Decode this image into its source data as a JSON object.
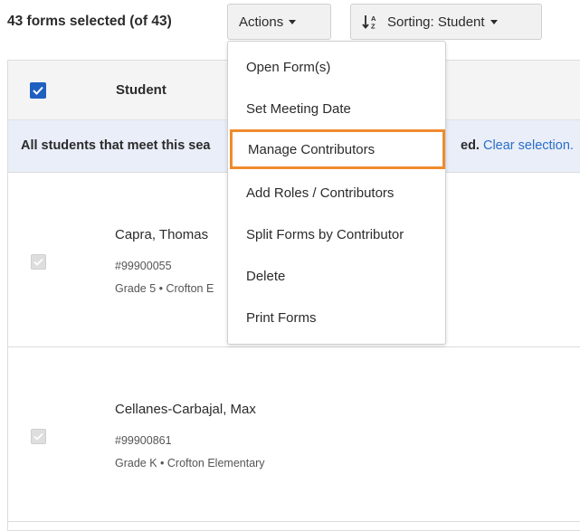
{
  "header": {
    "selection_count": "43 forms selected (of 43)",
    "actions_label": "Actions",
    "sorting_label": "Sorting: Student"
  },
  "table": {
    "column_student": "Student",
    "banner_text": "All students that meet this sea",
    "banner_tail": "ed.",
    "banner_link": "Clear selection."
  },
  "rows": [
    {
      "name": "Capra, Thomas",
      "id": "#99900055",
      "grade": "Grade 5 • Crofton E"
    },
    {
      "name": "Cellanes-Carbajal, Max",
      "id": "#99900861",
      "grade": "Grade K • Crofton Elementary"
    }
  ],
  "menu": {
    "items": [
      {
        "label": "Open Form(s)"
      },
      {
        "label": "Set Meeting Date"
      },
      {
        "label": "Manage Contributors"
      },
      {
        "label": "Add Roles / Contributors"
      },
      {
        "label": "Split Forms by Contributor"
      },
      {
        "label": "Delete"
      },
      {
        "label": "Print Forms"
      }
    ],
    "highlighted_item": "Manage Contributors",
    "highlight_color": "#f08b2e"
  },
  "colors": {
    "accent": "#1f5fbf",
    "link": "#2a6ec9",
    "banner_bg": "#e9eef8"
  }
}
